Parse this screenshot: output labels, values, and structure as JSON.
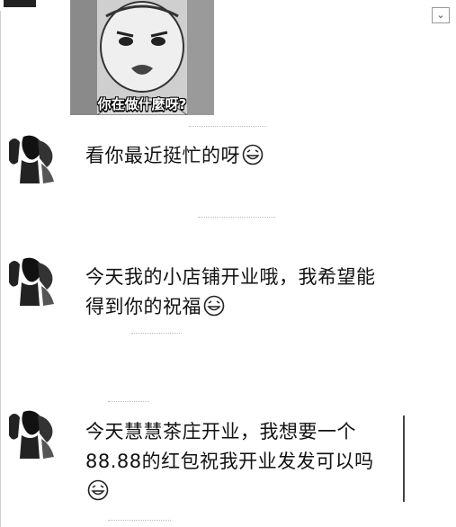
{
  "meme": {
    "caption": "你在做什麼呀?"
  },
  "top_corner": {
    "label": ""
  },
  "messages": [
    {
      "text": "看你最近挺忙的呀"
    },
    {
      "line1": "今天我的小店铺开业哦，我希望能",
      "line2": "得到你的祝福"
    },
    {
      "line1": "今天慧慧茶庄开业，我想要一个",
      "line2": "88.88的红包祝我开业发发可以吗"
    }
  ],
  "emoji": {
    "icon": "grin-emoji-icon"
  },
  "colors": {
    "background": "#ffffff",
    "text": "#111111"
  }
}
